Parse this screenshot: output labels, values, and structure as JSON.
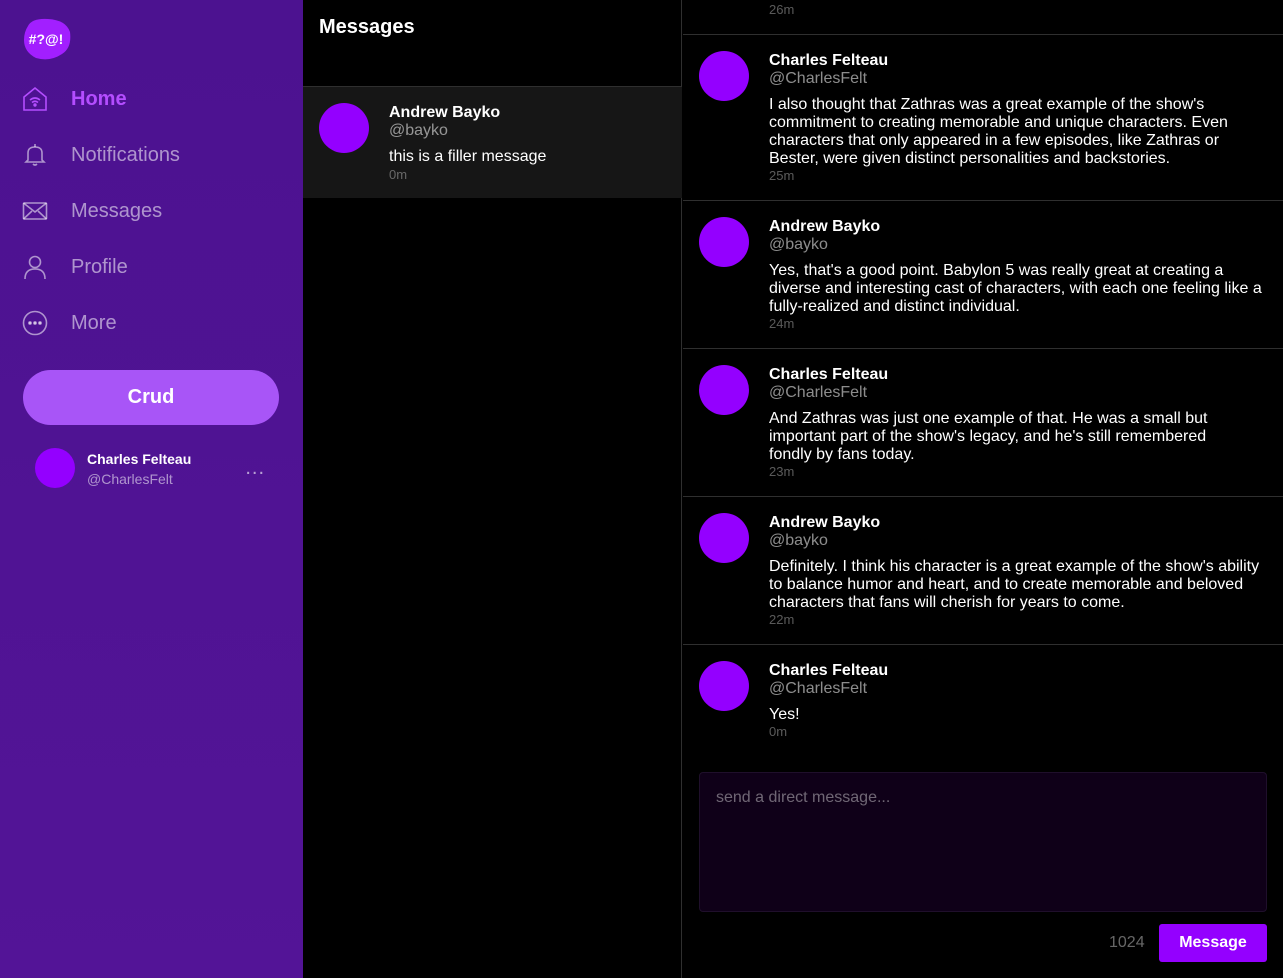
{
  "colors": {
    "sidebar": "#4c1290",
    "accent": "#9400ff",
    "accent_light": "#a855f7",
    "active_nav": "#b44dff"
  },
  "sidebar": {
    "logo_text": "#?@!",
    "nav": [
      {
        "label": "Home",
        "icon": "home-icon",
        "active": true
      },
      {
        "label": "Notifications",
        "icon": "bell-icon"
      },
      {
        "label": "Messages",
        "icon": "envelope-icon"
      },
      {
        "label": "Profile",
        "icon": "person-icon"
      },
      {
        "label": "More",
        "icon": "more-circle-icon"
      }
    ],
    "crud_label": "Crud",
    "user": {
      "name": "Charles Felteau",
      "handle": "@CharlesFelt",
      "more": "..."
    }
  },
  "threads": {
    "title": "Messages",
    "items": [
      {
        "name": "Andrew Bayko",
        "handle": "@bayko",
        "message": "this is a filler message",
        "time": "0m"
      }
    ]
  },
  "conversation": {
    "partial_time": "26m",
    "messages": [
      {
        "name": "Charles Felteau",
        "handle": "@CharlesFelt",
        "text": "I also thought that Zathras was a great example of the show's commitment to creating memorable and unique characters. Even characters that only appeared in a few episodes, like Zathras or Bester, were given distinct personalities and backstories.",
        "time": "25m"
      },
      {
        "name": "Andrew Bayko",
        "handle": "@bayko",
        "text": "Yes, that's a good point. Babylon 5 was really great at creating a diverse and interesting cast of characters, with each one feeling like a fully-realized and distinct individual.",
        "time": "24m"
      },
      {
        "name": "Charles Felteau",
        "handle": "@CharlesFelt",
        "text": "And Zathras was just one example of that. He was a small but important part of the show's legacy, and he's still remembered fondly by fans today.",
        "time": "23m"
      },
      {
        "name": "Andrew Bayko",
        "handle": "@bayko",
        "text": "Definitely. I think his character is a great example of the show's ability to balance humor and heart, and to create memorable and beloved characters that fans will cherish for years to come.",
        "time": "22m"
      },
      {
        "name": "Charles Felteau",
        "handle": "@CharlesFelt",
        "text": "Yes!",
        "time": "0m"
      }
    ],
    "composer": {
      "placeholder": "send a direct message...",
      "count": "1024",
      "send_label": "Message"
    }
  }
}
